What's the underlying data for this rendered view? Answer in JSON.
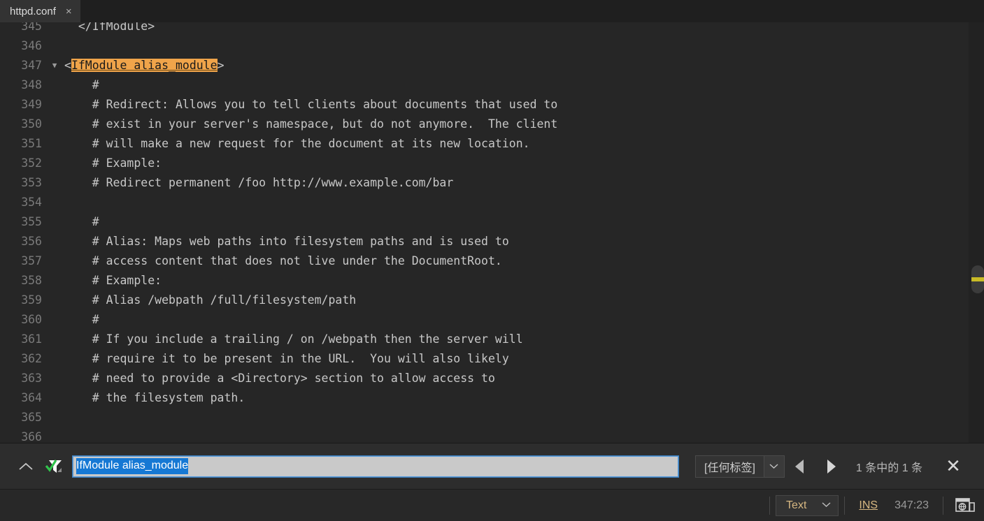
{
  "tab": {
    "label": "httpd.conf",
    "close": "×"
  },
  "editor": {
    "highlight_text": "IfModule alias_module",
    "lines": [
      {
        "num": "345",
        "fold": "",
        "pre": "  </IfModule>",
        "post": ""
      },
      {
        "num": "346",
        "fold": "",
        "pre": "",
        "post": ""
      },
      {
        "num": "347",
        "fold": "▼",
        "pre": "<",
        "post": ">",
        "highlight": true
      },
      {
        "num": "348",
        "fold": "",
        "pre": "    #",
        "post": ""
      },
      {
        "num": "349",
        "fold": "",
        "pre": "    # Redirect: Allows you to tell clients about documents that used to",
        "post": ""
      },
      {
        "num": "350",
        "fold": "",
        "pre": "    # exist in your server's namespace, but do not anymore.  The client",
        "post": ""
      },
      {
        "num": "351",
        "fold": "",
        "pre": "    # will make a new request for the document at its new location.",
        "post": ""
      },
      {
        "num": "352",
        "fold": "",
        "pre": "    # Example:",
        "post": ""
      },
      {
        "num": "353",
        "fold": "",
        "pre": "    # Redirect permanent /foo http://www.example.com/bar",
        "post": ""
      },
      {
        "num": "354",
        "fold": "",
        "pre": "",
        "post": ""
      },
      {
        "num": "355",
        "fold": "",
        "pre": "    #",
        "post": ""
      },
      {
        "num": "356",
        "fold": "",
        "pre": "    # Alias: Maps web paths into filesystem paths and is used to",
        "post": ""
      },
      {
        "num": "357",
        "fold": "",
        "pre": "    # access content that does not live under the DocumentRoot.",
        "post": ""
      },
      {
        "num": "358",
        "fold": "",
        "pre": "    # Example:",
        "post": ""
      },
      {
        "num": "359",
        "fold": "",
        "pre": "    # Alias /webpath /full/filesystem/path",
        "post": ""
      },
      {
        "num": "360",
        "fold": "",
        "pre": "    #",
        "post": ""
      },
      {
        "num": "361",
        "fold": "",
        "pre": "    # If you include a trailing / on /webpath then the server will",
        "post": ""
      },
      {
        "num": "362",
        "fold": "",
        "pre": "    # require it to be present in the URL.  You will also likely",
        "post": ""
      },
      {
        "num": "363",
        "fold": "",
        "pre": "    # need to provide a <Directory> section to allow access to",
        "post": ""
      },
      {
        "num": "364",
        "fold": "",
        "pre": "    # the filesystem path.",
        "post": ""
      },
      {
        "num": "365",
        "fold": "",
        "pre": "",
        "post": ""
      },
      {
        "num": "366",
        "fold": "",
        "pre": "",
        "post": ""
      }
    ]
  },
  "findbar": {
    "collapse_icon": "∧",
    "search_value": "IfModule alias_module",
    "tag_filter": "[任何标签]",
    "tag_caret": "⌄",
    "match_count": "1 条中的 1 条",
    "close_label": "✕"
  },
  "statusbar": {
    "syntax": "Text",
    "syntax_caret": "⌄",
    "insert_mode": "INS",
    "position": "347:23"
  },
  "colors": {
    "background": "#1f1f1f",
    "editor_bg": "#262626",
    "tab_bg": "#333333",
    "match_highlight": "#f0a44a",
    "selection_blue": "#1578d4",
    "scroll_marker": "#c9bb26",
    "accent_text": "#d7b882"
  }
}
